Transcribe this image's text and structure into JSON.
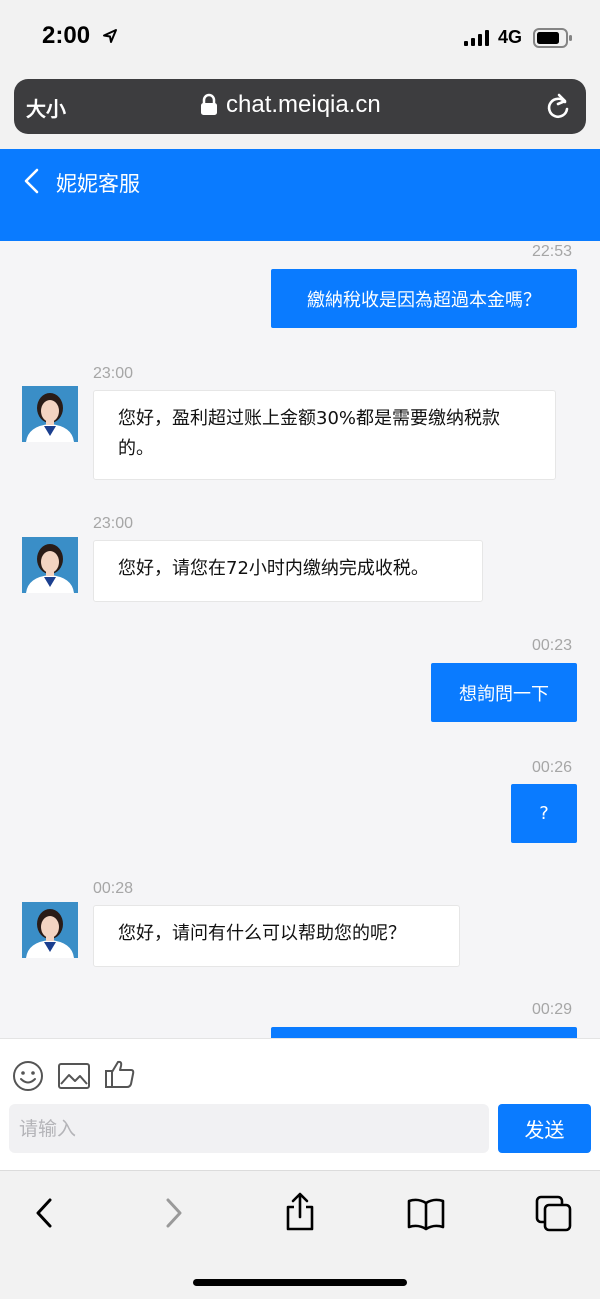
{
  "status_bar": {
    "time": "2:00",
    "network": "4G"
  },
  "address_bar": {
    "text_size_label": "大小",
    "url": "chat.meiqia.cn"
  },
  "chat": {
    "title": "妮妮客服",
    "messages": [
      {
        "direction": "out",
        "time": "22:53",
        "text": "繳納稅收是因為超過本金嗎？"
      },
      {
        "direction": "in",
        "time": "23:00",
        "text": "您好，盈利超过账上金额30%都是需要缴纳税款的。"
      },
      {
        "direction": "in",
        "time": "23:00",
        "text": "您好，请您在72小时内缴纳完成收税。"
      },
      {
        "direction": "out",
        "time": "00:23",
        "text": "想詢問一下"
      },
      {
        "direction": "out",
        "time": "00:26",
        "text": "?"
      },
      {
        "direction": "in",
        "time": "00:28",
        "text": "您好，请问有什么可以帮助您的呢？"
      },
      {
        "direction": "out",
        "time": "00:29",
        "text": ""
      }
    ]
  },
  "composer": {
    "placeholder": "请输入",
    "send_label": "发送"
  },
  "colors": {
    "accent": "#0a7bff",
    "background": "#f5f5f7",
    "timestamp": "#a6a6a6"
  },
  "icons": [
    "location-arrow-icon",
    "signal-icon",
    "battery-icon",
    "lock-icon",
    "reload-icon",
    "back-chevron-icon",
    "emoji-icon",
    "image-icon",
    "thumbs-up-icon",
    "browser-back-icon",
    "browser-forward-icon",
    "share-icon",
    "bookmarks-icon",
    "tabs-icon"
  ]
}
